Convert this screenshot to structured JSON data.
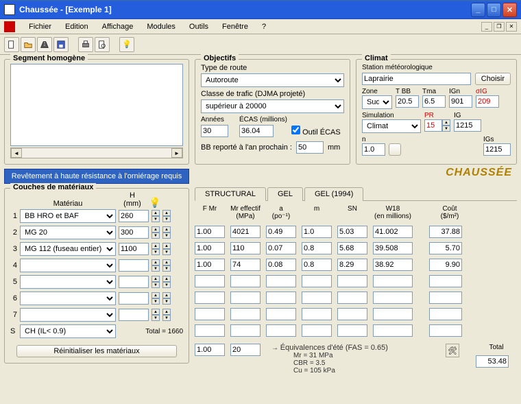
{
  "window": {
    "title": "Chaussée - [Exemple 1]"
  },
  "menu": [
    "Fichier",
    "Edition",
    "Affichage",
    "Modules",
    "Outils",
    "Fenêtre",
    "?"
  ],
  "segment": {
    "legend": "Segment homogène",
    "bluebar": "Revêtement à haute résistance à l'orniérage requis"
  },
  "objectifs": {
    "legend": "Objectifs",
    "type_label": "Type de route",
    "type_value": "Autoroute",
    "classe_label": "Classe de trafic (DJMA projeté)",
    "classe_value": "supérieur à 20000",
    "annees_label": "Années",
    "annees_value": "30",
    "ecas_label": "ÉCAS (millions)",
    "ecas_value": "36.04",
    "outil_label": "Outil ÉCAS",
    "bb_label": "BB reporté à l'an prochain :",
    "bb_value": "50",
    "bb_unit": "mm"
  },
  "climat": {
    "legend": "Climat",
    "station_label": "Station météorologique",
    "station_value": "Laprairie",
    "choisir": "Choisir",
    "zone_label": "Zone",
    "zone": "Sud",
    "tbb_label": "T BB",
    "tbb": "20.5",
    "tma_label": "Tma",
    "tma": "6.5",
    "ign_label": "IGn",
    "ign": "901",
    "sig_label": "σIG",
    "sig": "209",
    "sim_label": "Simulation",
    "sim": "Climat",
    "pr_label": "PR",
    "pr": "15",
    "ig_label": "IG",
    "ig": "1215",
    "n_label": "n",
    "n": "1.0",
    "igs_label": "IGs",
    "igs": "1215",
    "logo": "CHAUSSÉE"
  },
  "couches": {
    "legend": "Couches de matériaux",
    "materiau_label": "Matériau",
    "h_label": "H\n(mm)",
    "rows": [
      {
        "idx": "1",
        "mat": "BB HRO et BAF",
        "h": "260"
      },
      {
        "idx": "2",
        "mat": "MG  20",
        "h": "300"
      },
      {
        "idx": "3",
        "mat": "MG 112 (fuseau entier)",
        "h": "1100"
      },
      {
        "idx": "4",
        "mat": "",
        "h": ""
      },
      {
        "idx": "5",
        "mat": "",
        "h": ""
      },
      {
        "idx": "6",
        "mat": "",
        "h": ""
      },
      {
        "idx": "7",
        "mat": "",
        "h": ""
      }
    ],
    "s_idx": "S",
    "s_mat": "CH (IL< 0.9)",
    "total_label": "Total = 1660",
    "reset": "Réinitialiser les matériaux"
  },
  "tabs": [
    "STRUCTURAL",
    "GEL",
    "GEL (1994)"
  ],
  "structural": {
    "headers": {
      "fmr": "F Mr",
      "mr": "Mr effectif\n(MPa)",
      "a": "a\n(po⁻¹)",
      "m": "m",
      "sn": "SN",
      "w18": "W18\n(en millions)",
      "cout": "Coût\n($/m²)"
    },
    "rows": [
      {
        "fmr": "1.00",
        "mr": "4021",
        "a": "0.49",
        "m": "1.0",
        "sn": "5.03",
        "w18": "41.002",
        "cout": "37.88"
      },
      {
        "fmr": "1.00",
        "mr": "110",
        "a": "0.07",
        "m": "0.8",
        "sn": "5.68",
        "w18": "39.508",
        "cout": "5.70"
      },
      {
        "fmr": "1.00",
        "mr": "74",
        "a": "0.08",
        "m": "0.8",
        "sn": "8.29",
        "w18": "38.92",
        "cout": "9.90"
      },
      {
        "fmr": "",
        "mr": "",
        "a": "",
        "m": "",
        "sn": "",
        "w18": "",
        "cout": ""
      },
      {
        "fmr": "",
        "mr": "",
        "a": "",
        "m": "",
        "sn": "",
        "w18": "",
        "cout": ""
      },
      {
        "fmr": "",
        "mr": "",
        "a": "",
        "m": "",
        "sn": "",
        "w18": "",
        "cout": ""
      },
      {
        "fmr": "",
        "mr": "",
        "a": "",
        "m": "",
        "sn": "",
        "w18": "",
        "cout": ""
      }
    ],
    "srow": {
      "fmr": "1.00",
      "mr": "20"
    },
    "equiv": "Équivalences d'été  (FAS = 0.65)",
    "equiv2": "Mr = 31 MPa",
    "equiv3": "CBR = 3.5",
    "equiv4": "Cu = 105 kPa",
    "total_label": "Total",
    "total_value": "53.48"
  }
}
